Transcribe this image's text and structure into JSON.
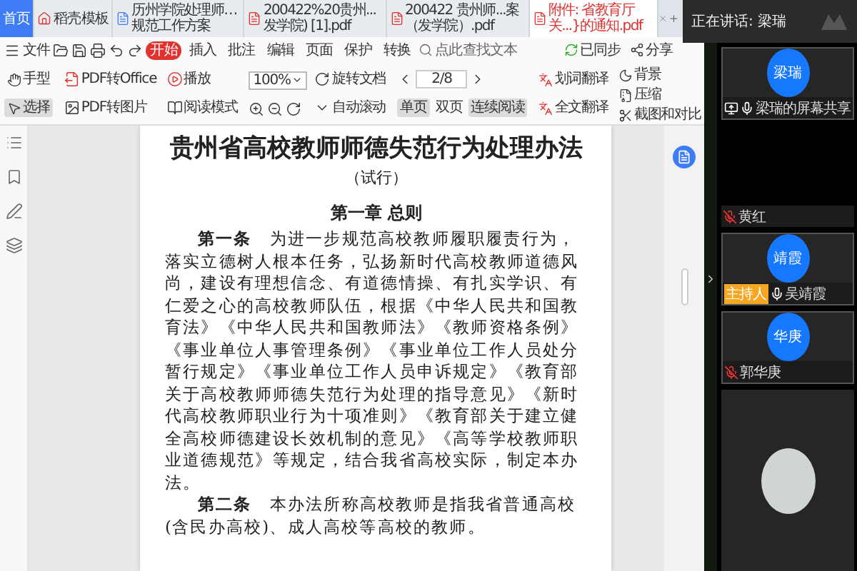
{
  "tabs": [
    {
      "label": "首页",
      "selected": false,
      "kind": "home"
    },
    {
      "label": "稻壳模板",
      "selected": false,
      "kind": "template"
    },
    {
      "label": "历州学院处理师…规范工作方案",
      "selected": false,
      "kind": "doc"
    },
    {
      "label": "200422%20贵州...发学院) [1].pdf",
      "selected": false,
      "kind": "pdf"
    },
    {
      "label": "200422 贵州师...案（发学院）.pdf",
      "selected": false,
      "kind": "pdf"
    },
    {
      "label": "附件: 省教育厅关...}的通知.pdf",
      "selected": true,
      "kind": "pdf"
    }
  ],
  "menu": {
    "file": "文件",
    "items": [
      {
        "label": "开始",
        "selected": true
      },
      {
        "label": "插入",
        "selected": false
      },
      {
        "label": "批注",
        "selected": false
      },
      {
        "label": "编辑",
        "selected": false
      },
      {
        "label": "页面",
        "selected": false
      },
      {
        "label": "保护",
        "selected": false
      },
      {
        "label": "转换",
        "selected": false
      }
    ],
    "search_placeholder": "点此查找文本",
    "sync": "已同步",
    "share": "分享"
  },
  "ribbon": {
    "tools": [
      {
        "label": "手型",
        "selected": false
      },
      {
        "label": "选择",
        "selected": true
      }
    ],
    "pdf_to_office": "PDF转Office",
    "pdf_to_image": "PDF转图片",
    "play": "播放",
    "read_mode": "阅读模式",
    "zoom": "100%",
    "rotate": "旋转文档",
    "page": "2/8",
    "view_modes": [
      {
        "label": "单页",
        "selected": true
      },
      {
        "label": "双页",
        "selected": false
      },
      {
        "label": "连续阅读",
        "selected": true
      }
    ],
    "auto_scroll": "自动滚动",
    "background": "背景",
    "word_translate": "划词翻译",
    "full_translate": "全文翻译",
    "compress": "压缩",
    "screenshot_compare": "截图和对比"
  },
  "document": {
    "title": "贵州省高校教师师德失范行为处理办法",
    "subtitle": "（试行）",
    "chapter": "第一章 总则",
    "paragraphs": [
      "**第一条**　为进一步规范高校教师履职履责行为，落实立德树人根本任务，弘扬新时代高校教师道德风尚，建设有理想信念、有道德情操、有扎实学识、有仁爱之心的高校教师队伍，根据《中华人民共和国教育法》《中华人民共和国教师法》《教师资格条例》《事业单位人事管理条例》《事业单位工作人员处分暂行规定》《事业单位工作人员申诉规定》《教育部关于高校教师师德失范行为处理的指导意见》《新时代高校教师职业行为十项准则》《教育部关于建立健全高校师德建设长效机制的意见》《高等学校教师职业道德规范》等规定，结合我省高校实际，制定本办法。",
      "**第二条**　本办法所称高校教师是指我省普通高校(含民办高校)、成人高校等高校的教师。"
    ]
  },
  "meeting": {
    "speaking": "正在讲话: 梁瑞",
    "participants": [
      {
        "kind": "avatar",
        "avatar": "梁瑞",
        "label": "梁瑞的屏幕共享",
        "muted": false,
        "sharing": true,
        "host": false
      },
      {
        "kind": "blank",
        "label": "黄红",
        "muted": true,
        "sharing": false,
        "host": false
      },
      {
        "kind": "avatar",
        "avatar": "靖霞",
        "label": "吴靖霞",
        "muted": false,
        "sharing": false,
        "host": true,
        "host_label": "主持人"
      },
      {
        "kind": "avatar",
        "avatar": "华庚",
        "label": "郭华庚",
        "muted": true,
        "sharing": false,
        "host": false
      },
      {
        "kind": "photo"
      }
    ]
  }
}
